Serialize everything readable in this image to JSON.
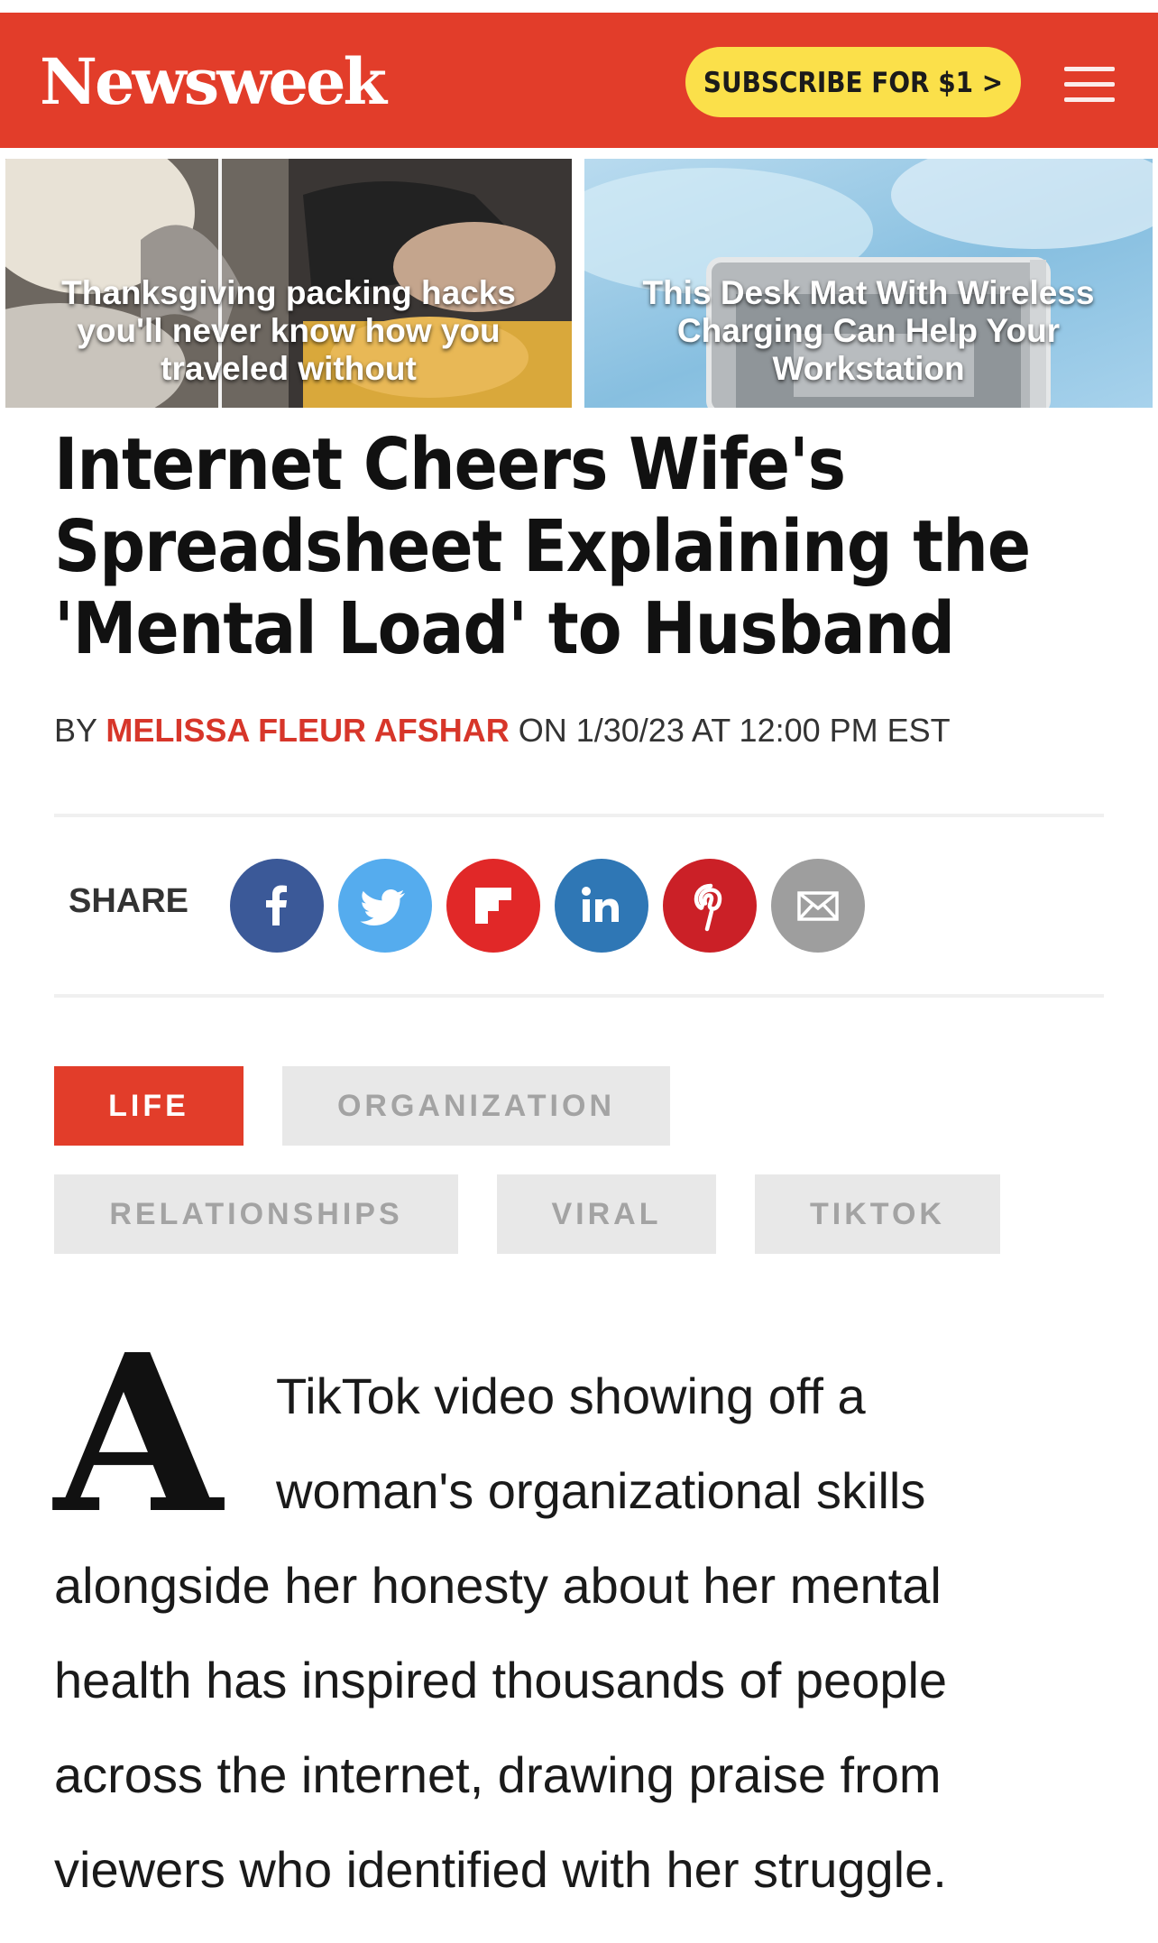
{
  "header": {
    "logo": "Newsweek",
    "subscribe_label": "SUBSCRIBE FOR $1  >",
    "colors": {
      "brand_red": "#e23d2a",
      "subscribe_yellow": "#fbe04a"
    }
  },
  "promos": [
    {
      "title": "Thanksgiving packing hacks you'll never know how you traveled without"
    },
    {
      "title": "This Desk Mat With Wireless Charging Can Help Your Workstation"
    }
  ],
  "article": {
    "headline": "Internet Cheers Wife's Spreadsheet Explaining the 'Mental Load' to Husband",
    "byline": {
      "by": "BY",
      "author": "MELISSA FLEUR AFSHAR",
      "date": "ON 1/30/23 AT 12:00 PM EST"
    },
    "share": {
      "label": "SHARE",
      "buttons": [
        {
          "network": "facebook",
          "icon": "facebook-icon",
          "color": "#3b5998"
        },
        {
          "network": "twitter",
          "icon": "twitter-icon",
          "color": "#55acee"
        },
        {
          "network": "flipboard",
          "icon": "flipboard-icon",
          "color": "#e12828"
        },
        {
          "network": "linkedin",
          "icon": "linkedin-icon",
          "color": "#2f77b5"
        },
        {
          "network": "pinterest",
          "icon": "pinterest-icon",
          "color": "#cb2027"
        },
        {
          "network": "email",
          "icon": "email-icon",
          "color": "#9e9e9e"
        }
      ]
    },
    "tags": [
      "LIFE",
      "ORGANIZATION",
      "RELATIONSHIPS",
      "VIRAL",
      "TIKTOK"
    ],
    "dropcap": "A",
    "body_lines": [
      "TikTok video showing off a",
      "woman's organizational skills",
      "alongside her honesty about her mental",
      "health has inspired thousands of people",
      "across the internet, drawing praise from",
      "viewers who identified with her struggle."
    ]
  }
}
